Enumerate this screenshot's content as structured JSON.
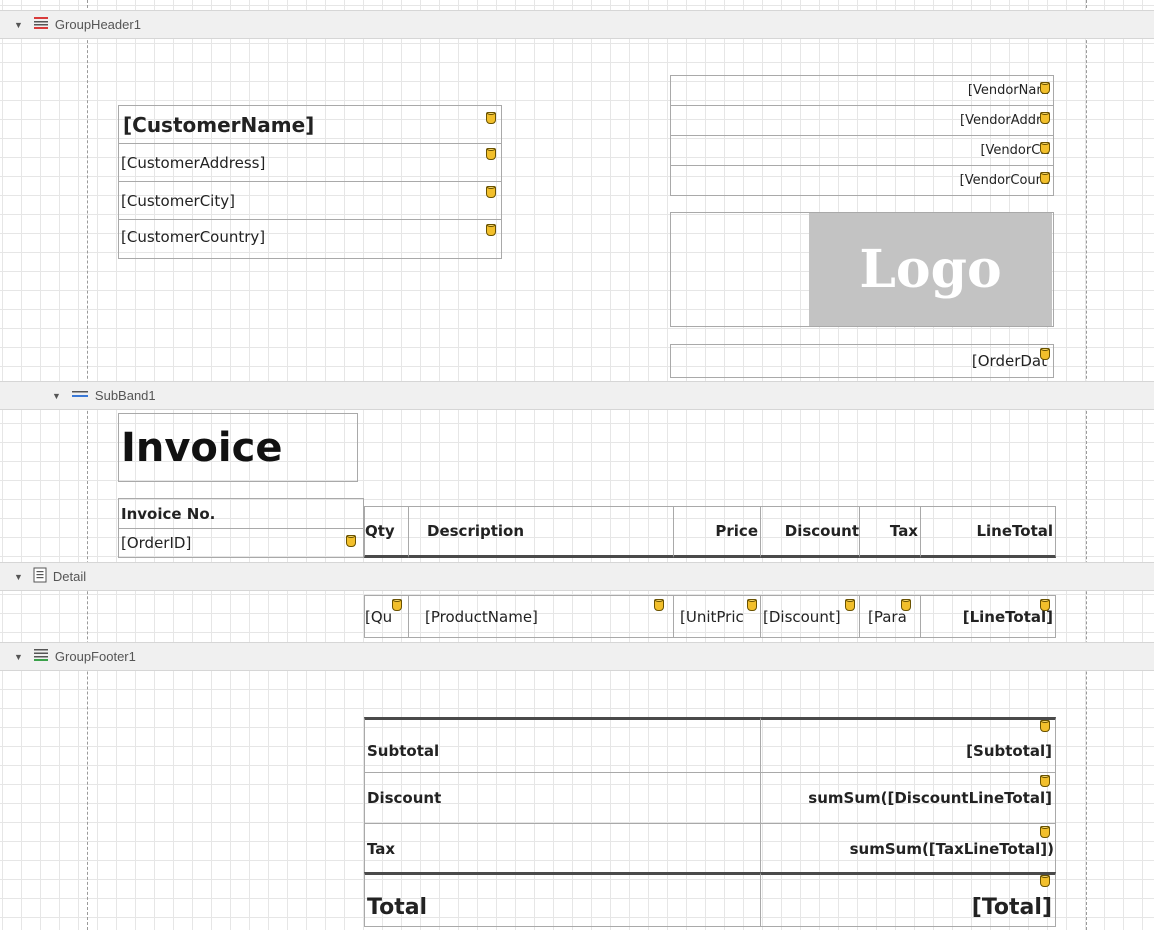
{
  "bands": {
    "group_header": "GroupHeader1",
    "sub_band": "SubBand1",
    "detail": "Detail",
    "group_footer": "GroupFooter1"
  },
  "customer": {
    "name": "[CustomerName]",
    "address": "[CustomerAddress]",
    "city": "[CustomerCity]",
    "country": "[CustomerCountry]"
  },
  "vendor": {
    "name": "[VendorNam",
    "address": "[VendorAddre",
    "city": "[VendorCit",
    "country": "[VendorCount"
  },
  "logo": "Logo",
  "order_date": "[OrderDat",
  "invoice": {
    "title": "Invoice",
    "number_label": "Invoice No.",
    "number_value": "[OrderID]"
  },
  "table_header": {
    "qty": "Qty",
    "description": "Description",
    "price": "Price",
    "discount": "Discount",
    "tax": "Tax",
    "line_total": "LineTotal"
  },
  "detail_row": {
    "qty": "[Qu",
    "product": "[ProductName]",
    "unit_price": "[UnitPric",
    "discount": "[Discount]",
    "tax": "[Para",
    "line_total": "[LineTotal]"
  },
  "totals": {
    "subtotal_label": "Subtotal",
    "subtotal_value": "[Subtotal]",
    "discount_label": "Discount",
    "discount_value": "sumSum([DiscountLineTotal]",
    "tax_label": "Tax",
    "tax_value": "sumSum([TaxLineTotal])",
    "total_label": "Total",
    "total_value": "[Total]"
  },
  "colors": {
    "band_bg": "#f0f0f0",
    "grid": "#e6e6e6",
    "border": "#a9a9a9",
    "logo_bg": "#c3c3c3",
    "field_icon": "#f2bf2b"
  }
}
